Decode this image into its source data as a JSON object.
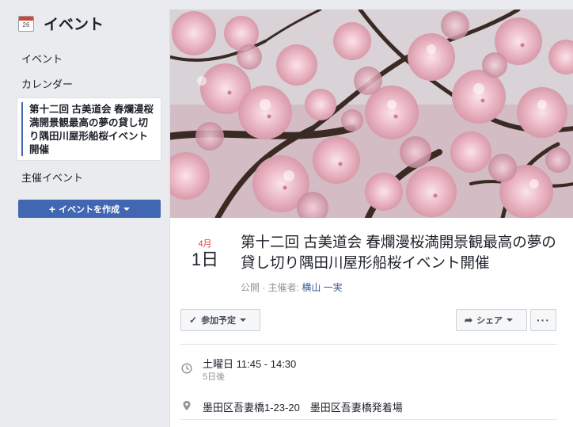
{
  "sidebar": {
    "calendar_icon_day": "26",
    "title": "イベント",
    "items": [
      {
        "label": "イベント"
      },
      {
        "label": "カレンダー"
      },
      {
        "label": "第十二回 古美道会 春爛漫桜満開景観最高の夢の貸し切り隅田川屋形船桜イベント開催"
      },
      {
        "label": "主催イベント"
      }
    ],
    "create_button": "イベントを作成"
  },
  "event": {
    "month": "4月",
    "day": "1日",
    "title": "第十二回 古美道会 春爛漫桜満開景観最高の夢の貸し切り隅田川屋形船桜イベント開催",
    "privacy": "公開 · 主催者: ",
    "host": "横山 一実",
    "actions": {
      "going": "参加予定",
      "share": "シェア",
      "more": "···"
    },
    "time": "土曜日 11:45 - 14:30",
    "time_relative": "5日後",
    "location": "墨田区吾妻橋1-23-20　墨田区吾妻橋発着場"
  },
  "colors": {
    "accent": "#4267b2",
    "month_red": "#e0403b",
    "link": "#365899"
  }
}
